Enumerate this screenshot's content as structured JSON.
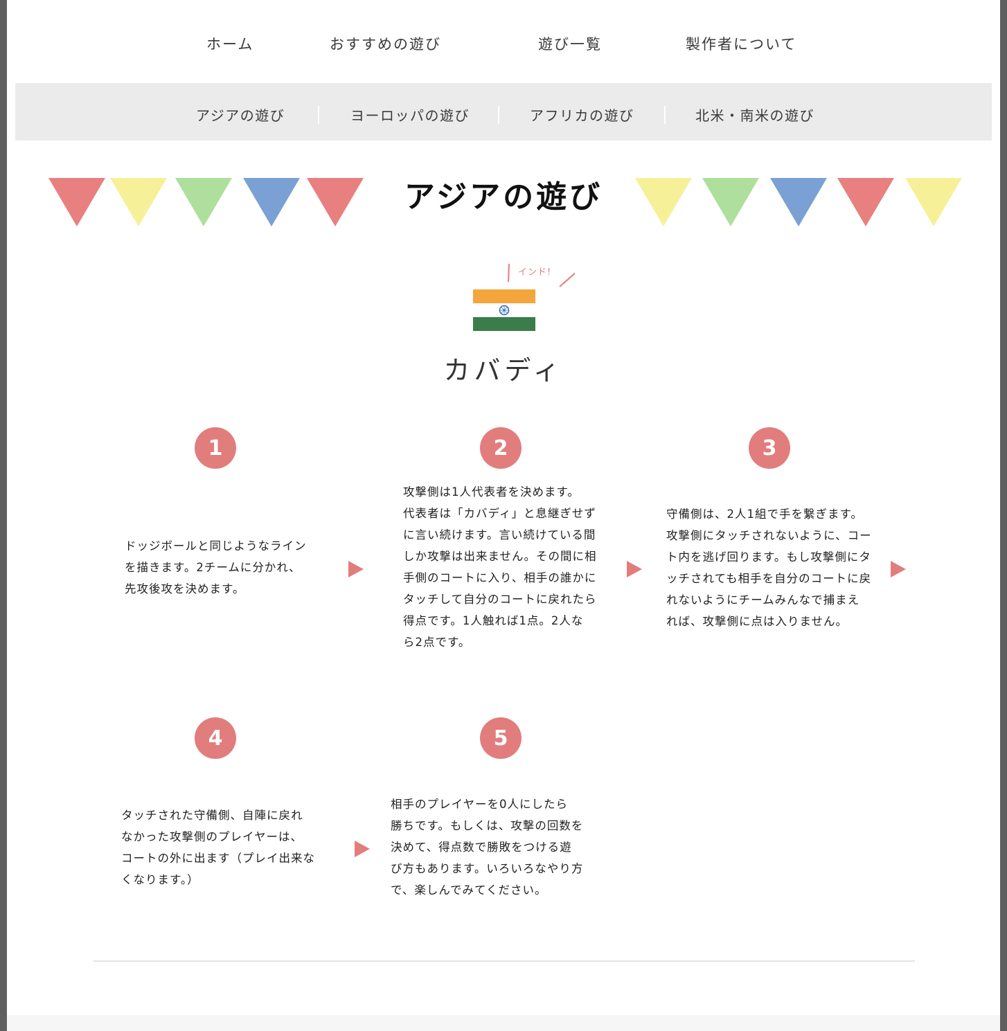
{
  "nav": {
    "items": [
      "ホーム",
      "おすすめの遊び",
      "遊び一覧",
      "製作者について"
    ]
  },
  "subnav": {
    "items": [
      "アジアの遊び",
      "ヨーロッパの遊び",
      "アフリカの遊び",
      "北米・南米の遊び"
    ]
  },
  "section": {
    "title": "アジアの遊び"
  },
  "colors": {
    "accent": "#e27d7d",
    "bunting_red": "#e88080",
    "bunting_yellow": "#f6f198",
    "bunting_green": "#aedf9c",
    "bunting_blue": "#7aa0d4",
    "flag_saffron": "#f3a63c",
    "flag_green": "#3a7d4b"
  },
  "game": {
    "country_callout": "インド!",
    "flag_icon": "india-flag-icon",
    "title": "カバディ"
  },
  "steps": [
    {
      "number": "1",
      "lines": [
        "ドッジボールと同じようなライン",
        "を描きます。2チームに分かれ、",
        "先攻後攻を決めます。"
      ]
    },
    {
      "number": "2",
      "lines": [
        "攻撃側は1人代表者を決めます。",
        "代表者は「カバディ」と息継ぎせず",
        "に言い続けます。言い続けている間",
        "しか攻撃は出来ません。その間に相",
        "手側のコートに入り、相手の誰かに",
        "タッチして自分のコートに戻れたら",
        "得点です。1人触れば1点。2人な",
        "ら2点です。"
      ]
    },
    {
      "number": "3",
      "lines": [
        "守備側は、2人1組で手を繋ぎます。",
        "攻撃側にタッチされないように、コー",
        "ト内を逃げ回ります。もし攻撃側にタ",
        "ッチされても相手を自分のコートに戻",
        "れないようにチームみんなで捕まえ",
        "れば、攻撃側に点は入りません。"
      ]
    },
    {
      "number": "4",
      "lines": [
        "タッチされた守備側、自陣に戻れ",
        "なかった攻撃側のプレイヤーは、",
        "コートの外に出ます（プレイ出来な",
        "くなります。）"
      ]
    },
    {
      "number": "5",
      "lines": [
        "相手のプレイヤーを0人にしたら",
        "勝ちです。もしくは、攻撃の回数を",
        "決めて、得点数で勝敗をつける遊",
        "び方もあります。いろいろなやり方",
        "で、楽しんでみてください。"
      ]
    }
  ]
}
